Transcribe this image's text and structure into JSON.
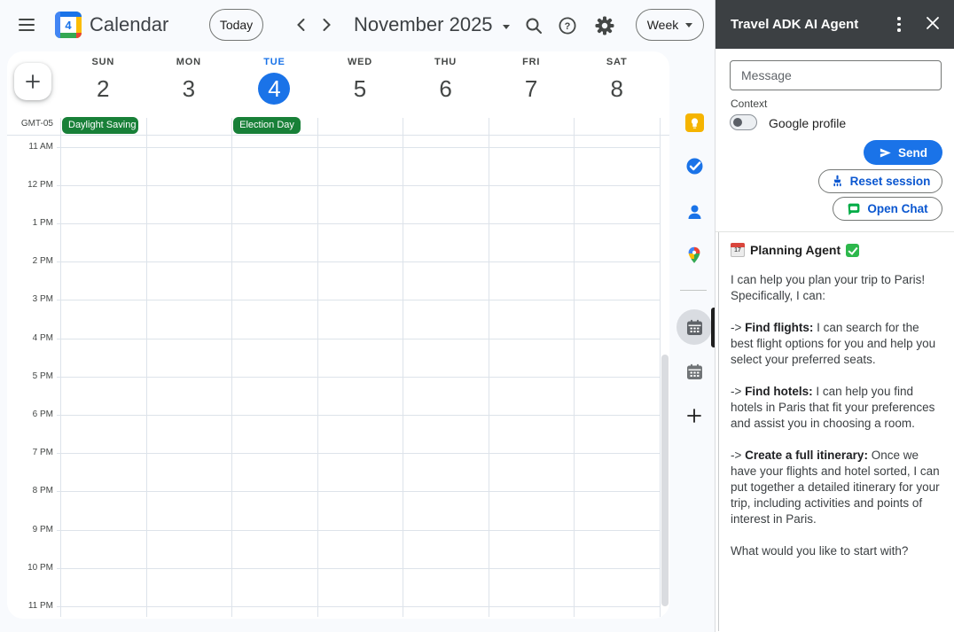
{
  "header": {
    "app_title": "Calendar",
    "logo_day": "4",
    "today_button": "Today",
    "month_label": "November 2025",
    "view_selector": "Week"
  },
  "calendar": {
    "timezone": "GMT-05",
    "days": [
      {
        "name": "SUN",
        "date": "2",
        "today": false
      },
      {
        "name": "MON",
        "date": "3",
        "today": false
      },
      {
        "name": "TUE",
        "date": "4",
        "today": true
      },
      {
        "name": "WED",
        "date": "5",
        "today": false
      },
      {
        "name": "THU",
        "date": "6",
        "today": false
      },
      {
        "name": "FRI",
        "date": "7",
        "today": false
      },
      {
        "name": "SAT",
        "date": "8",
        "today": false
      }
    ],
    "all_day_events": [
      {
        "label": "Daylight Saving Time",
        "day_index": 0
      },
      {
        "label": "Election Day",
        "day_index": 2
      }
    ],
    "hours": [
      "11 AM",
      "12 PM",
      "1 PM",
      "2 PM",
      "3 PM",
      "4 PM",
      "5 PM",
      "6 PM",
      "7 PM",
      "8 PM",
      "9 PM",
      "10 PM",
      "11 PM"
    ]
  },
  "rail": {
    "icons": [
      "keep-icon",
      "tasks-icon",
      "contacts-icon",
      "maps-icon",
      "calendar-active-icon",
      "calendar-icon",
      "plus-icon"
    ]
  },
  "panel": {
    "title": "Travel ADK AI Agent",
    "message_placeholder": "Message",
    "context_label": "Context",
    "toggle_label": "Google profile",
    "toggle_on": false,
    "send_label": "Send",
    "reset_label": "Reset session",
    "open_chat_label": "Open Chat",
    "chat": {
      "agent_title": "Planning Agent",
      "calendar_day": "17",
      "messages": [
        {
          "text": "I can help you plan your trip to Paris! Specifically, I can:"
        },
        {
          "prefix": "-> ",
          "bold": "Find flights:",
          "text": " I can search for the best flight options for you and help you select your preferred seats."
        },
        {
          "prefix": "-> ",
          "bold": "Find hotels:",
          "text": " I can help you find hotels in Paris that fit your preferences and assist you in choosing a room."
        },
        {
          "prefix": "-> ",
          "bold": "Create a full itinerary:",
          "text": " Once we have your flights and hotel sorted, I can put together a detailed itinerary for your trip, including activities and points of interest in Paris."
        },
        {
          "text": "What would you like to start with?"
        }
      ]
    }
  },
  "colors": {
    "accent_blue": "#1a73e8",
    "button_blue": "#0b57d0",
    "event_green": "#188038",
    "panel_header": "#3c4043",
    "background": "#f8fafd"
  }
}
